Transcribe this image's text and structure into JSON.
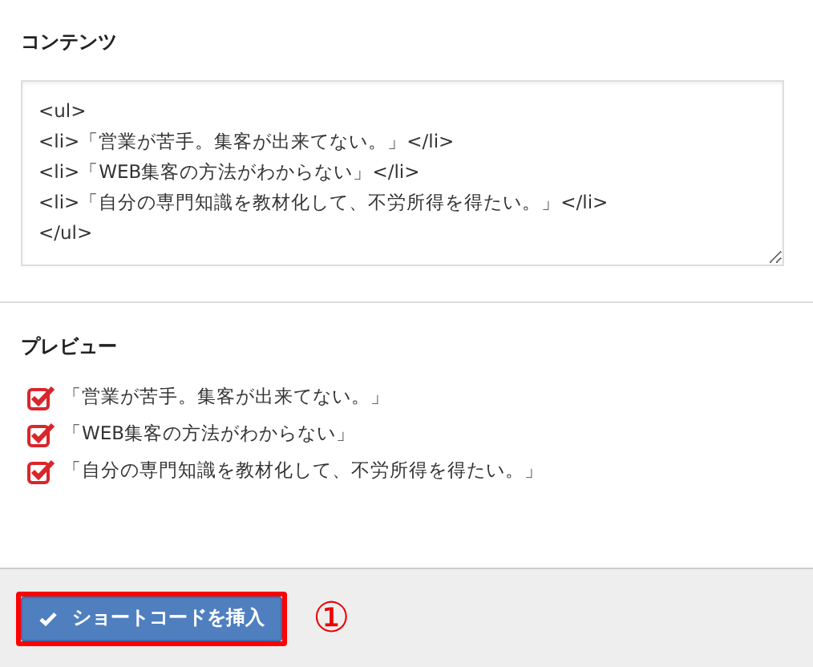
{
  "content_section": {
    "heading": "コンテンツ",
    "field": {
      "value": "<ul>\n<li>「営業が苦手。集客が出来てない。」</li>\n<li>「WEB集客の方法がわからない」</li>\n<li>「自分の専門知識を教材化して、不労所得を得たい。」</li>\n</ul>"
    }
  },
  "preview_section": {
    "heading": "プレビュー",
    "items": [
      {
        "label": "「営業が苦手。集客が出来てない。」",
        "checked": true
      },
      {
        "label": "「WEB集客の方法がわからない」",
        "checked": true
      },
      {
        "label": "「自分の専門知識を教材化して、不労所得を得たい。」",
        "checked": true
      }
    ]
  },
  "footer": {
    "button": {
      "label": "ショートコードを挿入",
      "highlighted": true
    },
    "annotation": "①"
  }
}
